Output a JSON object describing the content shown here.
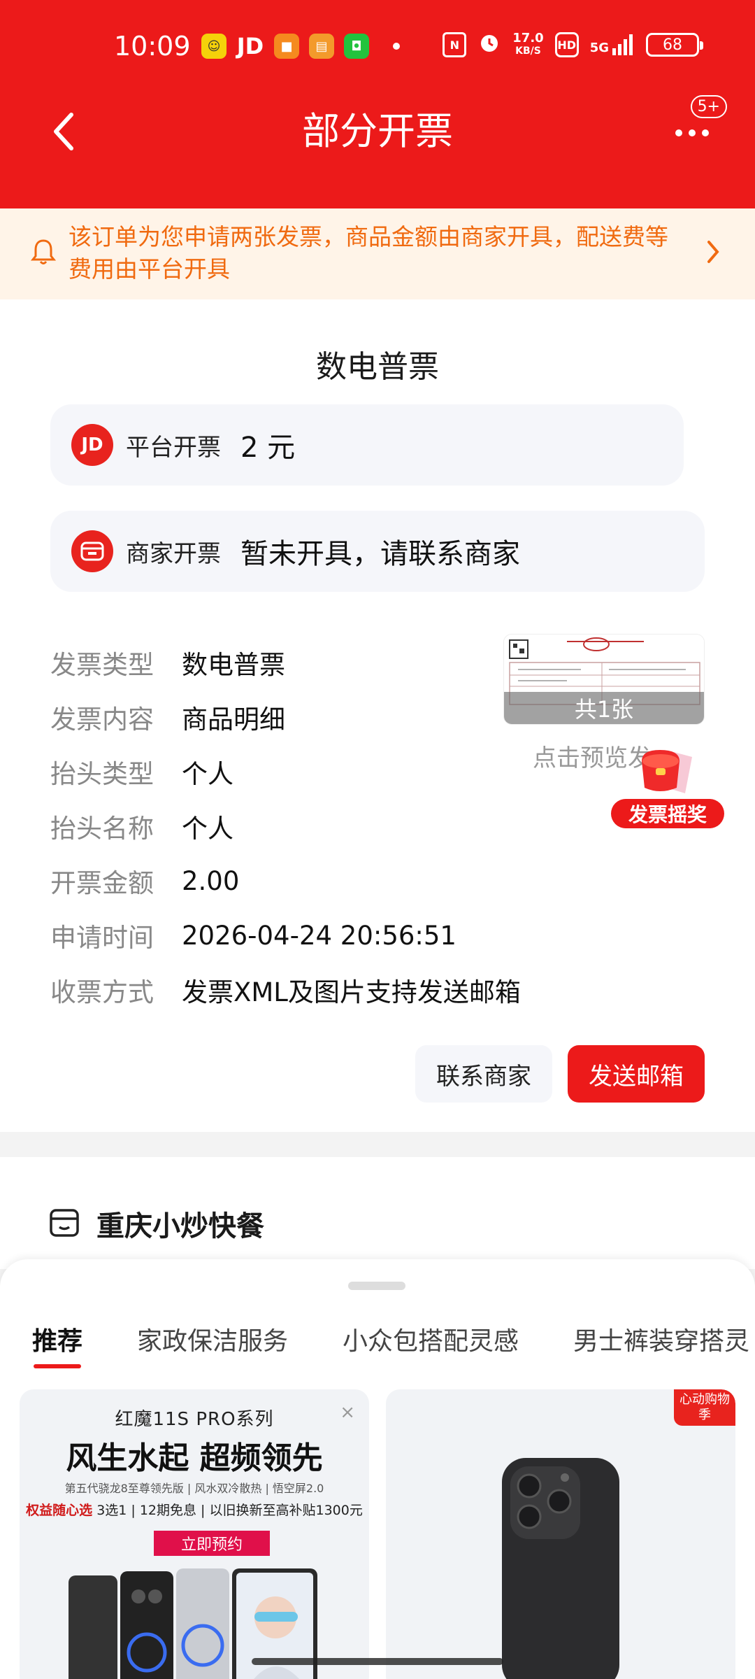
{
  "status_bar": {
    "time": "10:09",
    "net_speed_top": "17.0",
    "net_speed_unit": "KB/S",
    "hd": "HD",
    "signal": "5G",
    "battery": "68"
  },
  "header": {
    "title": "部分开票",
    "more_badge": "5+"
  },
  "notice": {
    "text": "该订单为您申请两张发票，商品金额由商家开具，配送费等费用由平台开具"
  },
  "invoice": {
    "doc_title": "数电普票",
    "platform": {
      "label": "平台开票",
      "value": "2 元",
      "logo": "JD"
    },
    "merchant": {
      "label": "商家开票",
      "value": "暂未开具，请联系商家"
    },
    "details": [
      {
        "key": "发票类型",
        "value": "数电普票"
      },
      {
        "key": "发票内容",
        "value": "商品明细"
      },
      {
        "key": "抬头类型",
        "value": "个人"
      },
      {
        "key": "抬头名称",
        "value": "个人"
      },
      {
        "key": "开票金额",
        "value": "2.00"
      },
      {
        "key": "申请时间",
        "value": "2026-04-24 20:56:51"
      },
      {
        "key": "收票方式",
        "value": "发票XML及图片支持发送邮箱"
      }
    ],
    "thumbnail_count": "共1张",
    "preview_hint": "点击预览发",
    "lottery_label": "发票摇奖",
    "contact_button": "联系商家",
    "email_button": "发送邮箱"
  },
  "shop": {
    "name": "重庆小炒快餐"
  },
  "recommend": {
    "tabs": [
      "推荐",
      "家政保洁服务",
      "小众包搭配灵感",
      "男士裤装穿搭灵"
    ],
    "product1": {
      "brand": "红魔11S PRO系列",
      "headline": "风生水起 超频领先",
      "sub": "第五代骁龙8至尊领先版 | 风水双冷散热 | 悟空屏2.0",
      "promo_prefix": "权益随心选",
      "promo_text": "3选1 | 12期免息 | 以旧换新至高补贴1300元",
      "cta": "立即预约"
    },
    "product2": {
      "tag": "心动购物季"
    }
  },
  "colors": {
    "brand_red": "#ec1a1a",
    "notice_text": "#f06a10",
    "notice_bg": "#fff4e8"
  }
}
